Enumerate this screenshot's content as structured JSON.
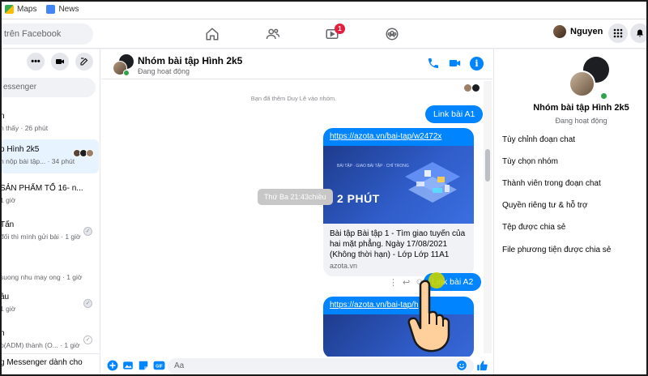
{
  "bookmarks": [
    {
      "label": "Maps",
      "color": "#34a853"
    },
    {
      "label": "News",
      "color": "#4285f4"
    }
  ],
  "topbar": {
    "search_placeholder": "trên Facebook",
    "notif_count": "1",
    "profile_name": "Nguyen"
  },
  "left": {
    "search_placeholder": "essenger",
    "conversations": [
      {
        "title": "n",
        "subtitle": "n thấy · 26 phút"
      },
      {
        "title": "p Hình 2k5",
        "subtitle": "n nộp bài tập... · 34 phút",
        "active": true
      },
      {
        "title": "SẢN PHẨM TỔ 16- n...",
        "subtitle": "1 giờ"
      },
      {
        "title": "Tấn",
        "subtitle": "đối thì mình gửi bài · 1 giờ"
      },
      {
        "title": "",
        "subtitle": "suong nhu may ong · 1 giờ"
      },
      {
        "title": "âu",
        "subtitle": "1 giờ"
      },
      {
        "title": "h",
        "subtitle": "p(ADM) thành (O... · 1 giờ"
      }
    ],
    "bottom_text": "g Messenger dành cho"
  },
  "chat": {
    "title": "Nhóm bài tập Hình 2k5",
    "status": "Đang hoạt động",
    "system_note": "Bạn đã thêm Duy Lê vào nhóm.",
    "bubble1": "Link bài A1",
    "card1": {
      "url": "https://azota.vn/bai-tap/w2472x",
      "thumb_label": "BÀI TẬP · GIAO BÀI TẬP · CHỈ TRONG",
      "thumb_big": "2 PHÚT",
      "desc": "Bài tập Bài tập 1 - Tìm giao tuyến của hai mặt phẳng. Ngày 17/08/2021 (Không thời hạn) - Lớp Lớp 11A1",
      "domain": "azota.vn"
    },
    "timestamp": "Thứ Ba 21:43chiều",
    "bubble2": "Link bài A2",
    "card2_url": "https://azota.vn/bai-tap/h",
    "composer_placeholder": "Aa"
  },
  "right": {
    "title": "Nhóm bài tập Hình 2k5",
    "status": "Đang hoạt động",
    "items": [
      "Tùy chỉnh đoạn chat",
      "Tùy chọn nhóm",
      "Thành viên trong đoạn chat",
      "Quyền riêng tư & hỗ trợ",
      "Tệp được chia sẻ",
      "File phương tiện được chia sẻ"
    ]
  },
  "colors": {
    "accent": "#0084ff",
    "online": "#31a24c",
    "badge": "#e41e3f"
  }
}
